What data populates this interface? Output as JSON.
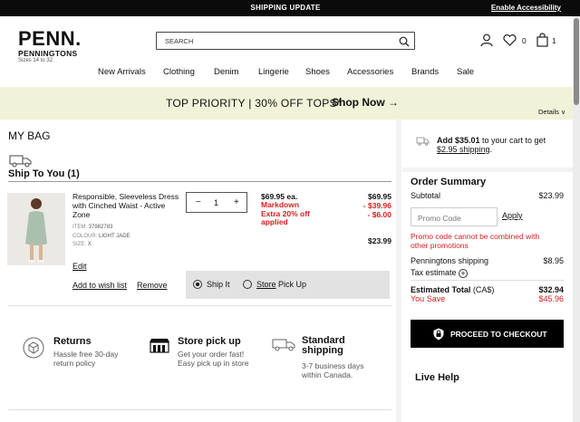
{
  "topbar": {
    "promo": "SHIPPING UPDATE",
    "accessibility": "Enable Accessibility"
  },
  "logo": {
    "main": "PENN.",
    "sub": "PENNINGTONS",
    "sizes": "Sizes 14 to 32"
  },
  "search": {
    "placeholder": "SEARCH"
  },
  "header": {
    "wishlist_count": "0",
    "cart_count": "1"
  },
  "nav": [
    "New Arrivals",
    "Clothing",
    "Denim",
    "Lingerie",
    "Shoes",
    "Accessories",
    "Brands",
    "Sale"
  ],
  "banner": {
    "message": "TOP PRIORITY | 30% OFF TOPS*",
    "cta": "Shop Now",
    "details": "Details"
  },
  "bag": {
    "title": "MY BAG",
    "ship_to_you": "Ship To You (1)",
    "item": {
      "name": "Responsible, Sleeveless Dress with Cinched Waist - Active Zone",
      "item_label": "ITEM:",
      "item_no": "37982783",
      "colour_label": "COLOUR:",
      "colour": "LIGHT JADE",
      "size_label": "SIZE:",
      "size": "X",
      "qty": "1",
      "price_each": "$69.95 ea.",
      "markdown": "Markdown",
      "extra": "Extra 20% off applied",
      "orig": "$69.95",
      "markdown_amt": "- $39.96",
      "extra_amt": "- $6.00",
      "total": "$23.99",
      "edit": "Edit",
      "wishlist": "Add to wish list",
      "remove": "Remove",
      "ship_it": "Ship It",
      "store_u": "Store",
      "store_rest": " Pick Up"
    }
  },
  "features": [
    {
      "title": "Returns",
      "desc": "Hassle free 30-day return policy"
    },
    {
      "title": "Store pick up",
      "desc": "Get your order fast! Easy pick up in store"
    },
    {
      "title": "Standard shipping",
      "desc": "3-7 business days within Canada."
    }
  ],
  "shipping_promo": {
    "add": "Add $35.01",
    "rest": " to your cart to get ",
    "link": "$2.95 shipping",
    "end": "."
  },
  "summary": {
    "title": "Order Summary",
    "subtotal_label": "Subtotal",
    "subtotal": "$23.99",
    "promo_placeholder": "Promo Code",
    "apply": "Apply",
    "promo_error": "Promo code cannot be combined with other promotions",
    "shipping_label": "Penningtons shipping",
    "shipping": "$8.95",
    "tax_label": "Tax estimate",
    "total_label": "Estimated Total",
    "total_ccy": " (CA$)",
    "total": "$32.94",
    "save_label": "You Save",
    "save": "$45.96",
    "checkout": "PROCEED TO CHECKOUT",
    "live_help": "Live Help"
  },
  "colors": {
    "sale_red": "#d32020",
    "banner_bg": "#f0f3d8",
    "topbar_bg": "#0b0b0b"
  }
}
